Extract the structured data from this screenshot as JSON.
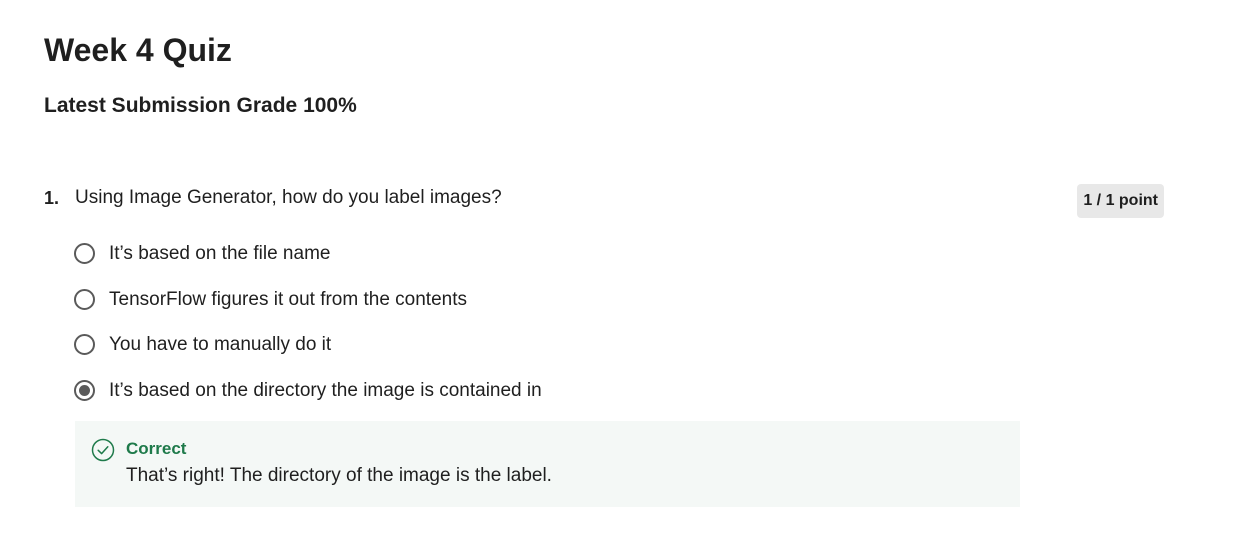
{
  "quiz": {
    "title": "Week 4 Quiz",
    "grade_text": "Latest Submission Grade 100%"
  },
  "question": {
    "number": "1.",
    "text": "Using Image Generator, how do you label images?",
    "points": "1 / 1 point",
    "options": [
      {
        "label": "It’s based on the file name",
        "selected": false
      },
      {
        "label": "TensorFlow figures it out from the contents",
        "selected": false
      },
      {
        "label": "You have to manually do it",
        "selected": false
      },
      {
        "label": "It’s based on the directory the image is contained in",
        "selected": true
      }
    ]
  },
  "feedback": {
    "icon": "check-circle-icon",
    "status": "Correct",
    "message": "That’s right! The directory of the image is the label.",
    "status_color": "#1e7a4a"
  }
}
